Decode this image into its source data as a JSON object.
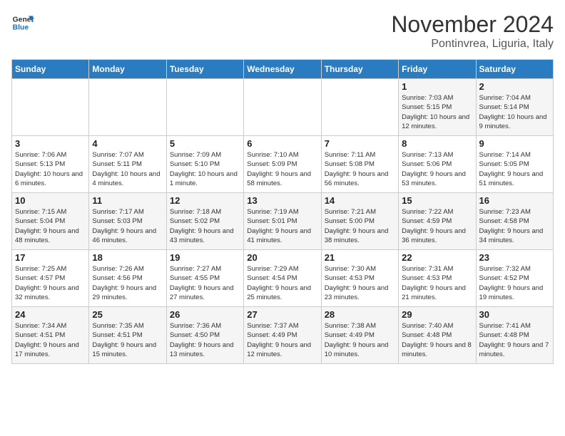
{
  "logo": {
    "line1": "General",
    "line2": "Blue"
  },
  "header": {
    "month": "November 2024",
    "location": "Pontinvrea, Liguria, Italy"
  },
  "weekdays": [
    "Sunday",
    "Monday",
    "Tuesday",
    "Wednesday",
    "Thursday",
    "Friday",
    "Saturday"
  ],
  "weeks": [
    [
      {
        "day": "",
        "info": ""
      },
      {
        "day": "",
        "info": ""
      },
      {
        "day": "",
        "info": ""
      },
      {
        "day": "",
        "info": ""
      },
      {
        "day": "",
        "info": ""
      },
      {
        "day": "1",
        "info": "Sunrise: 7:03 AM\nSunset: 5:15 PM\nDaylight: 10 hours and 12 minutes."
      },
      {
        "day": "2",
        "info": "Sunrise: 7:04 AM\nSunset: 5:14 PM\nDaylight: 10 hours and 9 minutes."
      }
    ],
    [
      {
        "day": "3",
        "info": "Sunrise: 7:06 AM\nSunset: 5:13 PM\nDaylight: 10 hours and 6 minutes."
      },
      {
        "day": "4",
        "info": "Sunrise: 7:07 AM\nSunset: 5:11 PM\nDaylight: 10 hours and 4 minutes."
      },
      {
        "day": "5",
        "info": "Sunrise: 7:09 AM\nSunset: 5:10 PM\nDaylight: 10 hours and 1 minute."
      },
      {
        "day": "6",
        "info": "Sunrise: 7:10 AM\nSunset: 5:09 PM\nDaylight: 9 hours and 58 minutes."
      },
      {
        "day": "7",
        "info": "Sunrise: 7:11 AM\nSunset: 5:08 PM\nDaylight: 9 hours and 56 minutes."
      },
      {
        "day": "8",
        "info": "Sunrise: 7:13 AM\nSunset: 5:06 PM\nDaylight: 9 hours and 53 minutes."
      },
      {
        "day": "9",
        "info": "Sunrise: 7:14 AM\nSunset: 5:05 PM\nDaylight: 9 hours and 51 minutes."
      }
    ],
    [
      {
        "day": "10",
        "info": "Sunrise: 7:15 AM\nSunset: 5:04 PM\nDaylight: 9 hours and 48 minutes."
      },
      {
        "day": "11",
        "info": "Sunrise: 7:17 AM\nSunset: 5:03 PM\nDaylight: 9 hours and 46 minutes."
      },
      {
        "day": "12",
        "info": "Sunrise: 7:18 AM\nSunset: 5:02 PM\nDaylight: 9 hours and 43 minutes."
      },
      {
        "day": "13",
        "info": "Sunrise: 7:19 AM\nSunset: 5:01 PM\nDaylight: 9 hours and 41 minutes."
      },
      {
        "day": "14",
        "info": "Sunrise: 7:21 AM\nSunset: 5:00 PM\nDaylight: 9 hours and 38 minutes."
      },
      {
        "day": "15",
        "info": "Sunrise: 7:22 AM\nSunset: 4:59 PM\nDaylight: 9 hours and 36 minutes."
      },
      {
        "day": "16",
        "info": "Sunrise: 7:23 AM\nSunset: 4:58 PM\nDaylight: 9 hours and 34 minutes."
      }
    ],
    [
      {
        "day": "17",
        "info": "Sunrise: 7:25 AM\nSunset: 4:57 PM\nDaylight: 9 hours and 32 minutes."
      },
      {
        "day": "18",
        "info": "Sunrise: 7:26 AM\nSunset: 4:56 PM\nDaylight: 9 hours and 29 minutes."
      },
      {
        "day": "19",
        "info": "Sunrise: 7:27 AM\nSunset: 4:55 PM\nDaylight: 9 hours and 27 minutes."
      },
      {
        "day": "20",
        "info": "Sunrise: 7:29 AM\nSunset: 4:54 PM\nDaylight: 9 hours and 25 minutes."
      },
      {
        "day": "21",
        "info": "Sunrise: 7:30 AM\nSunset: 4:53 PM\nDaylight: 9 hours and 23 minutes."
      },
      {
        "day": "22",
        "info": "Sunrise: 7:31 AM\nSunset: 4:53 PM\nDaylight: 9 hours and 21 minutes."
      },
      {
        "day": "23",
        "info": "Sunrise: 7:32 AM\nSunset: 4:52 PM\nDaylight: 9 hours and 19 minutes."
      }
    ],
    [
      {
        "day": "24",
        "info": "Sunrise: 7:34 AM\nSunset: 4:51 PM\nDaylight: 9 hours and 17 minutes."
      },
      {
        "day": "25",
        "info": "Sunrise: 7:35 AM\nSunset: 4:51 PM\nDaylight: 9 hours and 15 minutes."
      },
      {
        "day": "26",
        "info": "Sunrise: 7:36 AM\nSunset: 4:50 PM\nDaylight: 9 hours and 13 minutes."
      },
      {
        "day": "27",
        "info": "Sunrise: 7:37 AM\nSunset: 4:49 PM\nDaylight: 9 hours and 12 minutes."
      },
      {
        "day": "28",
        "info": "Sunrise: 7:38 AM\nSunset: 4:49 PM\nDaylight: 9 hours and 10 minutes."
      },
      {
        "day": "29",
        "info": "Sunrise: 7:40 AM\nSunset: 4:48 PM\nDaylight: 9 hours and 8 minutes."
      },
      {
        "day": "30",
        "info": "Sunrise: 7:41 AM\nSunset: 4:48 PM\nDaylight: 9 hours and 7 minutes."
      }
    ]
  ]
}
